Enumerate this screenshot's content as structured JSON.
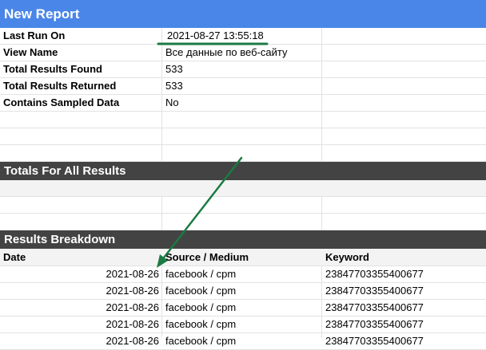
{
  "report": {
    "title": "New Report"
  },
  "meta": [
    {
      "label": "Last Run On",
      "value": "2021-08-27 13:55:18"
    },
    {
      "label": "View Name",
      "value": "Все данные по веб-сайту"
    },
    {
      "label": "Total Results Found",
      "value": "533"
    },
    {
      "label": "Total Results Returned",
      "value": "533"
    },
    {
      "label": "Contains Sampled Data",
      "value": "No"
    }
  ],
  "totals": {
    "title": "Totals For All Results"
  },
  "breakdown": {
    "title": "Results Breakdown",
    "headers": [
      "Date",
      "Source / Medium",
      "Keyword"
    ],
    "rows": [
      {
        "date": "2021-08-26",
        "source": "facebook / cpm",
        "keyword": "23847703355400677"
      },
      {
        "date": "2021-08-26",
        "source": "facebook / cpm",
        "keyword": "23847703355400677"
      },
      {
        "date": "2021-08-26",
        "source": "facebook / cpm",
        "keyword": "23847703355400677"
      },
      {
        "date": "2021-08-26",
        "source": "facebook / cpm",
        "keyword": "23847703355400677"
      },
      {
        "date": "2021-08-26",
        "source": "facebook / cpm",
        "keyword": "23847703355400677"
      }
    ]
  },
  "colors": {
    "title_bar": "#4a86e8",
    "section_bar": "#434343",
    "annotation": "#1b7a43"
  }
}
